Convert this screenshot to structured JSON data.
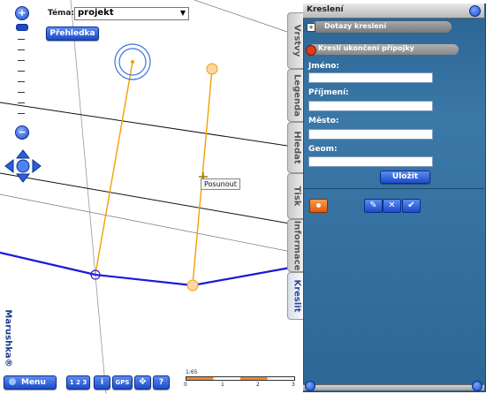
{
  "theme": {
    "label": "Téma:",
    "value": "projekt"
  },
  "overview_button": "Přehledka",
  "map": {
    "tooltip": "Posunout",
    "logo": "Marushka®"
  },
  "scale": {
    "label": "1:65",
    "ticks": [
      "0",
      "1",
      "2",
      "3"
    ]
  },
  "bottom_toolbar": {
    "menu": "Menu",
    "scale_btn": "1 2 3",
    "info_btn": "i",
    "gps_btn": "GPS",
    "help_btn": "?"
  },
  "panel": {
    "title": "Kreslení",
    "query_header": "Dotazy kreslení",
    "section_header": "Kreslí ukončení přípojky",
    "fields": [
      {
        "label": "Jméno:",
        "value": ""
      },
      {
        "label": "Příjmení:",
        "value": ""
      },
      {
        "label": "Město:",
        "value": ""
      },
      {
        "label": "Geom:",
        "value": ""
      }
    ],
    "save_button": "Uložit"
  },
  "side_tabs": [
    "Vrstvy",
    "Legenda",
    "Hledat",
    "Tisk",
    "Informace",
    "Kreslit"
  ],
  "colors": {
    "accent_blue": "#1c4cc8",
    "line_orange": "#f4a000",
    "panel_bg": "#2a6494"
  }
}
